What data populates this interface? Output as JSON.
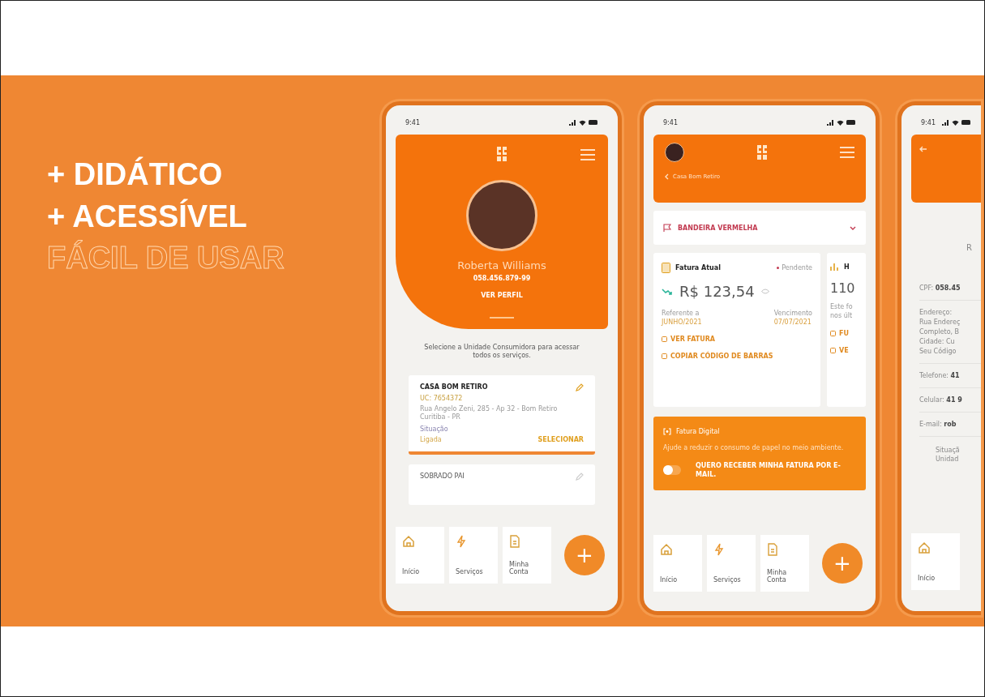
{
  "headline": {
    "lines": [
      {
        "text": "+ DIDÁTICO",
        "kind": "solid"
      },
      {
        "text": "+ ACESSÍVEL",
        "kind": "solid"
      },
      {
        "text": "FÁCIL DE USAR",
        "kind": "outline"
      }
    ]
  },
  "phones": [
    {
      "kind": "profile",
      "time": "9:41",
      "user": {
        "name": "Roberta Williams",
        "document": "058.456.879-99",
        "link": "VER PERFIL"
      },
      "hint": "Selecione a Unidade Consumidora para acessar todos os serviços.",
      "units": [
        {
          "name": "CASA BOM RETIRO",
          "code": "UC: 7654372",
          "address": "Rua Angelo Zeni, 285 - Ap 32 - Bom Retiro Curitiba - PR",
          "status_label": "Situação",
          "status": "Ligada",
          "action": "SELECIONAR",
          "selected": true
        },
        {
          "name": "SOBRADO PAI",
          "selected": false
        }
      ],
      "nav": [
        {
          "label": "Início"
        },
        {
          "label": "Serviços"
        },
        {
          "label": "Minha Conta"
        }
      ],
      "fab": "+"
    },
    {
      "kind": "invoice",
      "time": "9:41",
      "back": "Casa Bom Retiro",
      "alert": "BANDEIRA VERMELHA",
      "cards": [
        {
          "title": "Fatura Atual",
          "badge": "Pendente",
          "amount": "R$ 123,54",
          "ref_label": "Referente a",
          "ref": "JUNHO/2021",
          "due_label": "Vencimento",
          "due": "07/07/2021",
          "links": [
            "VER FATURA",
            "COPIAR CÓDIGO DE BARRAS"
          ]
        },
        {
          "title": "H",
          "amount": "110",
          "text": [
            "Este fo",
            "nos últ"
          ],
          "links": [
            "FU",
            "VE"
          ]
        }
      ],
      "digital": {
        "title": "Fatura Digital",
        "text": "Ajude a reduzir o consumo de papel no meio ambiente.",
        "on": false,
        "label": "QUERO RECEBER MINHA FATURA POR E-MAIL."
      },
      "nav": [
        {
          "label": "Início"
        },
        {
          "label": "Serviços"
        },
        {
          "label": "Minha Conta"
        }
      ],
      "fab": "+"
    },
    {
      "kind": "details",
      "time": "9:41",
      "title": "R",
      "fields": [
        {
          "label": "CPF:",
          "value": "058.45"
        },
        {
          "lines": [
            "Endereço:",
            "Rua Endereç",
            "Completo, B",
            "Cidade: Cu",
            "Seu Código"
          ]
        },
        {
          "label": "Telefone:",
          "value": "41"
        },
        {
          "label": "Celular:",
          "value": "41 9"
        },
        {
          "label": "E-mail:",
          "value": "rob"
        }
      ],
      "note": [
        "Situaçã",
        "Unidad"
      ],
      "nav": [
        {
          "label": "Início"
        }
      ]
    }
  ]
}
